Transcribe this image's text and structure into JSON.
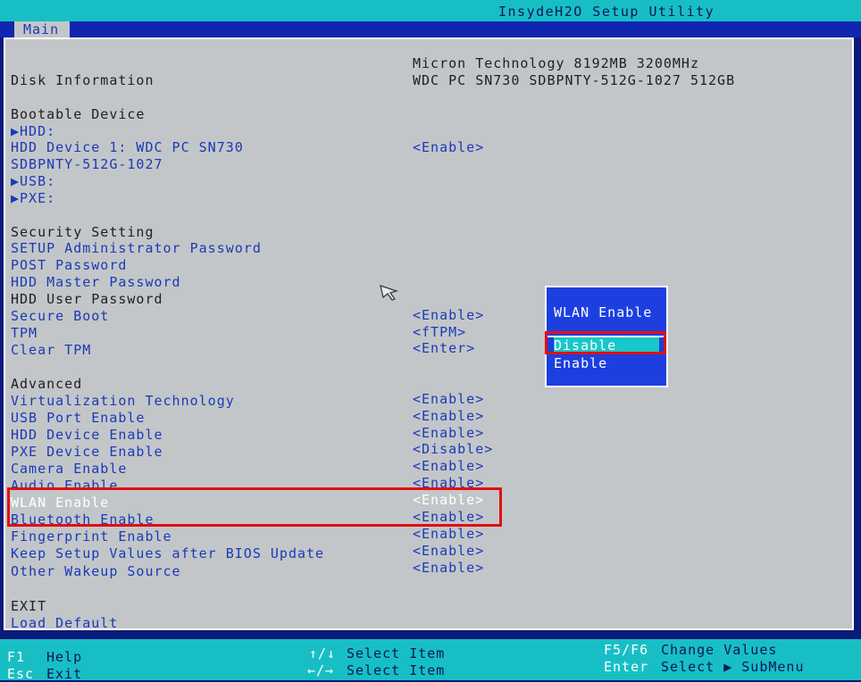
{
  "title": "InsydeH2O Setup Utility",
  "tabs": [
    {
      "label": "Main"
    }
  ],
  "system_info": {
    "memory": "Micron Technology 8192MB 3200MHz",
    "disk_label": "Disk Information",
    "disk_value": "WDC PC SN730 SDBPNTY-512G-1027 512GB"
  },
  "bootable": {
    "header": "Bootable Device",
    "hdd": "▶HDD:",
    "hdd_device_line1": "HDD Device 1: WDC PC SN730",
    "hdd_device_line2": "SDBPNTY-512G-1027",
    "hdd_device_value": "<Enable>",
    "usb": "▶USB:",
    "pxe": "▶PXE:"
  },
  "security": {
    "header": "Security Setting",
    "items": [
      {
        "label": "SETUP Administrator Password",
        "value": ""
      },
      {
        "label": "POST Password",
        "value": ""
      },
      {
        "label": "HDD Master Password",
        "value": ""
      },
      {
        "label": "HDD User Password",
        "value": ""
      },
      {
        "label": "Secure Boot",
        "value": "<Enable>"
      },
      {
        "label": "TPM",
        "value": "<fTPM>"
      },
      {
        "label": "Clear TPM",
        "value": "<Enter>"
      }
    ]
  },
  "advanced": {
    "header": "Advanced",
    "items": [
      {
        "label": "Virtualization Technology",
        "value": "<Enable>"
      },
      {
        "label": "USB Port Enable",
        "value": "<Enable>"
      },
      {
        "label": "HDD Device Enable",
        "value": "<Enable>"
      },
      {
        "label": "PXE Device Enable",
        "value": "<Disable>"
      },
      {
        "label": "Camera Enable",
        "value": "<Enable>"
      },
      {
        "label": "Audio Enable",
        "value": "<Enable>"
      },
      {
        "label": "WLAN Enable",
        "value": "<Enable>"
      },
      {
        "label": "Bluetooth Enable",
        "value": "<Enable>"
      },
      {
        "label": "Fingerprint Enable",
        "value": "<Enable>"
      },
      {
        "label": "Keep Setup Values after BIOS Update",
        "value": "<Enable>"
      },
      {
        "label": "Other Wakeup Source",
        "value": "<Enable>"
      }
    ]
  },
  "exit": {
    "header": "EXIT",
    "load_default": "Load Default"
  },
  "popup": {
    "title": "WLAN Enable",
    "options": [
      "Disable",
      "Enable"
    ],
    "selected": "Disable"
  },
  "footer": {
    "f1_key": "F1",
    "f1_action": "Help",
    "esc_key": "Esc",
    "esc_action": "Exit",
    "updown_key": "↑/↓",
    "updown_action": "Select Item",
    "leftright_key": "←/→",
    "leftright_action": "Select Item",
    "f5f6_key": "F5/F6",
    "f5f6_action": "Change Values",
    "enter_key": "Enter",
    "enter_action": "Select ▶ SubMenu"
  },
  "colors": {
    "bios_blue": "#0a1a7a",
    "panel_gray": "#c3c6c8",
    "title_cyan": "#17bfc4",
    "item_blue": "#1a3ab8",
    "popup_blue": "#1d3fe0",
    "highlight_red": "#e01010"
  }
}
